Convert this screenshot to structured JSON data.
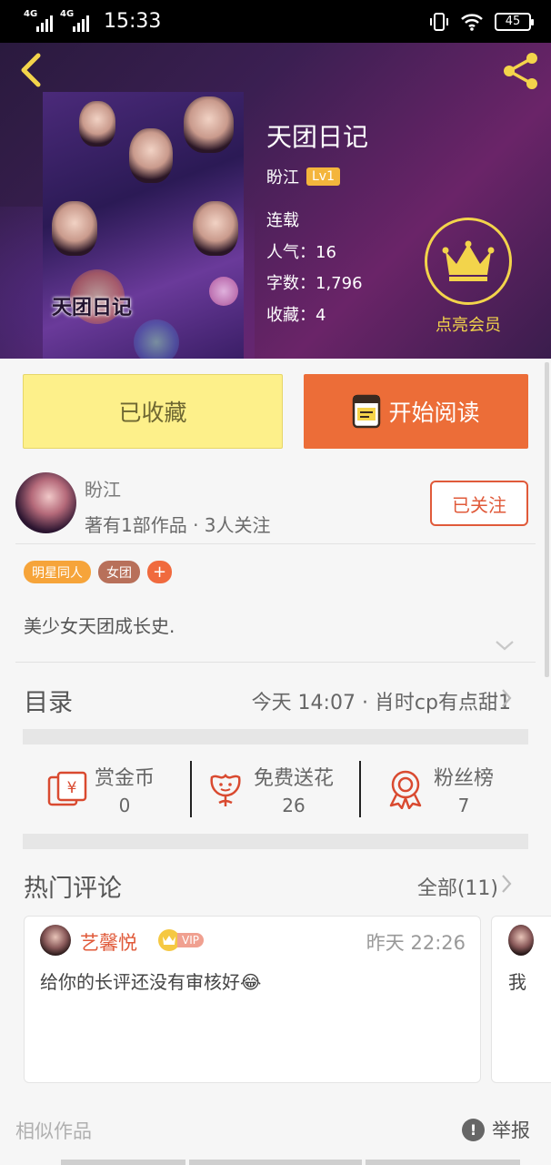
{
  "status_bar": {
    "network1": "4G",
    "network2": "4G",
    "time": "15:33",
    "battery": "45"
  },
  "book": {
    "title": "天团日记",
    "cover_text": "天团日记",
    "author": "盼江",
    "level": "Lv1",
    "status": "连载",
    "popularity_label": "人气：",
    "popularity": "16",
    "wordcount_label": "字数：",
    "wordcount": "1,796",
    "favorites_label": "收藏：",
    "favorites": "4",
    "vip_label": "点亮会员"
  },
  "actions": {
    "fav_label": "已收藏",
    "read_label": "开始阅读"
  },
  "author_card": {
    "name": "盼江",
    "stats": "著有1部作品 · 3人关注",
    "follow_label": "已关注"
  },
  "tags": [
    {
      "label": "明星同人",
      "color": "#f6a43a"
    },
    {
      "label": "女团",
      "color": "#b8705a"
    }
  ],
  "tag_add": "+",
  "description": "美少女天团成长史.",
  "catalog": {
    "title": "目录",
    "latest": "今天 14:07 · 肖时cp有点甜1"
  },
  "stats": [
    {
      "label": "赏金币",
      "value": "0",
      "icon": "reward-coin-icon"
    },
    {
      "label": "免费送花",
      "value": "26",
      "icon": "flower-icon"
    },
    {
      "label": "粉丝榜",
      "value": "7",
      "icon": "medal-icon"
    }
  ],
  "comments": {
    "title": "热门评论",
    "all_label": "全部(11)",
    "items": [
      {
        "name": "艺馨悦",
        "vip": "VIP",
        "time": "昨天 22:26",
        "text": "给你的长评还没有审核好😂"
      },
      {
        "text": "我"
      }
    ]
  },
  "footer": {
    "similar": "相似作品",
    "report": "举报",
    "report_icon": "!"
  },
  "colors": {
    "accent_orange": "#ec6d38",
    "fav_yellow": "#fdf08a",
    "vip_gold": "#f3d44b",
    "follow_red": "#e05a3a"
  }
}
